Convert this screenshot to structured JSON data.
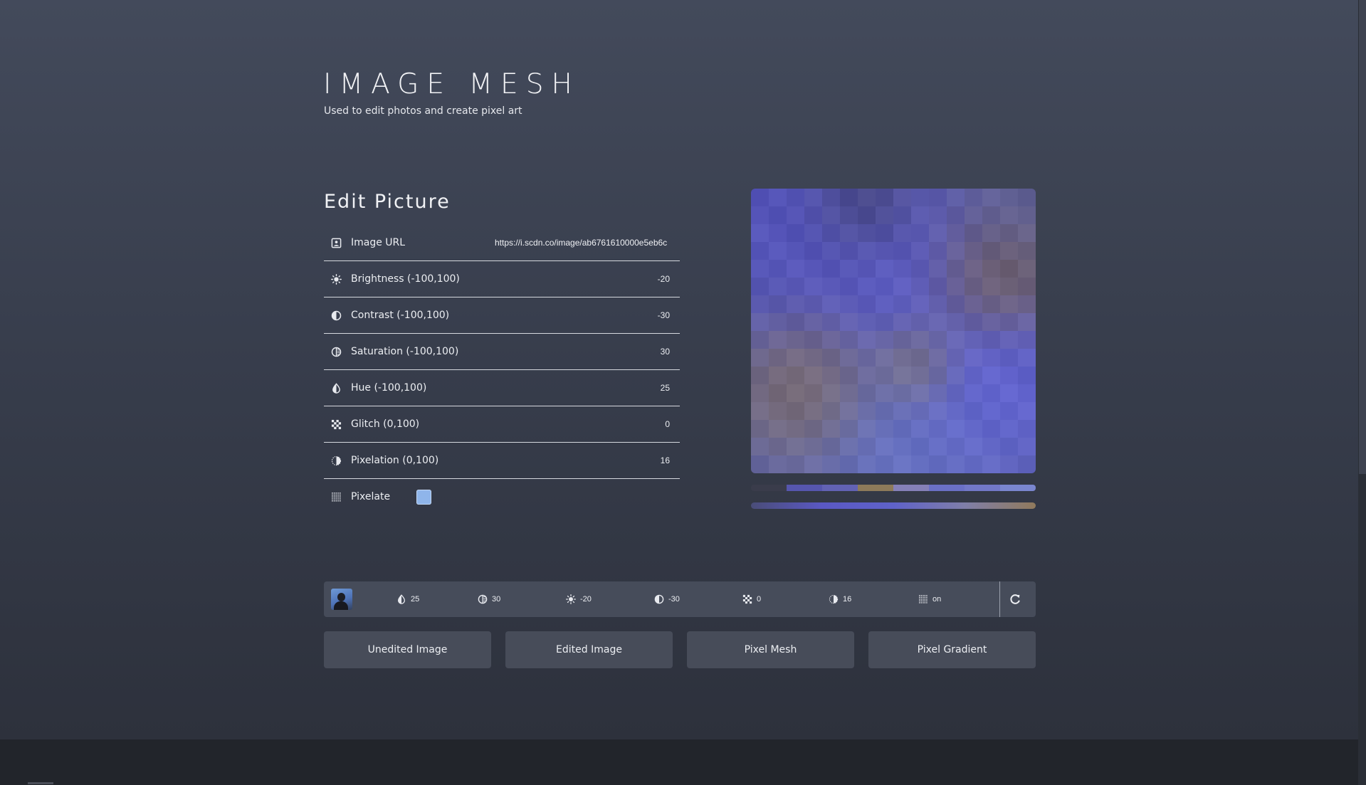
{
  "header": {
    "title": "IMAGE MESH",
    "subtitle": "Used to edit photos and create pixel art"
  },
  "editor": {
    "section_title": "Edit Picture",
    "image_url": {
      "label": "Image URL",
      "value": "https://i.scdn.co/image/ab6761610000e5eb6c",
      "icon": "image-icon"
    },
    "settings": [
      {
        "key": "brightness",
        "label": "Brightness (-100,100)",
        "value": "-20",
        "icon": "sun-icon"
      },
      {
        "key": "contrast",
        "label": "Contrast (-100,100)",
        "value": "-30",
        "icon": "contrast-icon"
      },
      {
        "key": "saturation",
        "label": "Saturation (-100,100)",
        "value": "30",
        "icon": "saturation-icon"
      },
      {
        "key": "hue",
        "label": "Hue (-100,100)",
        "value": "25",
        "icon": "drop-icon"
      },
      {
        "key": "glitch",
        "label": "Glitch (0,100)",
        "value": "0",
        "icon": "checker-icon"
      },
      {
        "key": "pixelation",
        "label": "Pixelation (0,100)",
        "value": "16",
        "icon": "dither-icon"
      }
    ],
    "pixelate": {
      "label": "Pixelate",
      "checked": true,
      "icon": "grid-icon"
    }
  },
  "preview": {
    "palette": [
      "#3a3c4b",
      "#5656ae",
      "#6262b4",
      "#8d7a5a",
      "#8580b8",
      "#6a70c6",
      "#7278c8",
      "#7a86cf"
    ],
    "gradient": [
      "#4a4d78",
      "#5a58c4",
      "#5f62c9",
      "#7f7ea8",
      "#907a5c"
    ]
  },
  "summary": {
    "items": [
      {
        "key": "hue",
        "icon": "drop-icon",
        "value": "25"
      },
      {
        "key": "saturation",
        "icon": "saturation-icon",
        "value": "30"
      },
      {
        "key": "brightness",
        "icon": "sun-icon",
        "value": "-20"
      },
      {
        "key": "contrast",
        "icon": "contrast-icon",
        "value": "-30"
      },
      {
        "key": "glitch",
        "icon": "checker-icon",
        "value": "0"
      },
      {
        "key": "pixelation",
        "icon": "dither-icon",
        "value": "16"
      },
      {
        "key": "pixelate",
        "icon": "grid-icon",
        "value": "on"
      }
    ],
    "refresh_icon": "refresh-icon"
  },
  "actions": [
    "Unedited Image",
    "Edited Image",
    "Pixel Mesh",
    "Pixel Gradient"
  ],
  "colors": {
    "background_top": "#434a5b",
    "background_bottom": "#2d313c",
    "panel": "#474c59",
    "checkbox": "#8fb5ea",
    "text": "#eceef2"
  }
}
